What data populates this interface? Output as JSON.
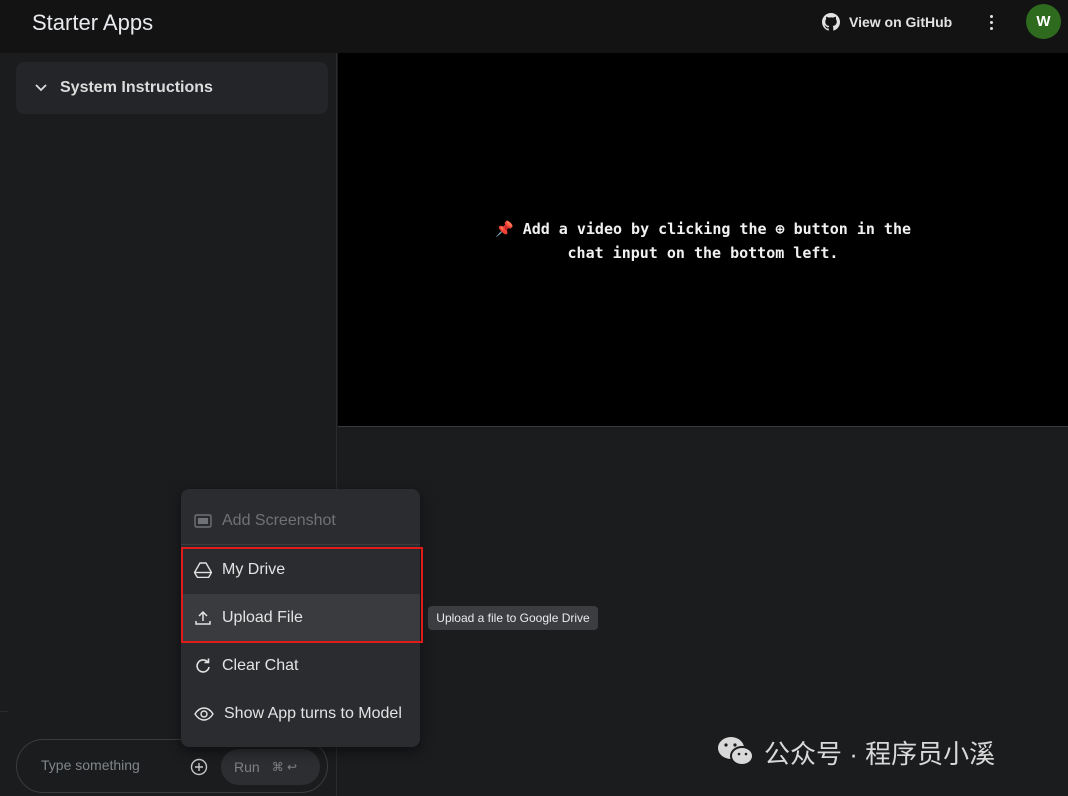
{
  "header": {
    "title": "Starter Apps",
    "github_label": "View on GitHub",
    "avatar_initial": "W"
  },
  "sidebar": {
    "system_instructions_label": "System Instructions"
  },
  "chat_input": {
    "placeholder": "Type something",
    "run_label": "Run",
    "shortcut": "⌘ ↩"
  },
  "video": {
    "pin_icon": "📌",
    "message_line1": "Add a video by clicking the ⊕ button in the",
    "message_line2": "chat input on the bottom left."
  },
  "menu": {
    "items": [
      {
        "label": "Add Screenshot",
        "icon": "screenshot-icon",
        "disabled": true
      },
      {
        "label": "My Drive",
        "icon": "drive-icon",
        "disabled": false
      },
      {
        "label": "Upload File",
        "icon": "upload-icon",
        "disabled": false
      },
      {
        "label": "Clear Chat",
        "icon": "refresh-icon",
        "disabled": false
      },
      {
        "label": "Show App turns to Model",
        "icon": "eye-icon",
        "disabled": false
      }
    ]
  },
  "tooltip": {
    "text": "Upload a file to Google Drive"
  },
  "watermark": {
    "text": "公众号 · 程序员小溪"
  },
  "colors": {
    "highlight": "#e01b1b",
    "avatar": "#2e6b1e"
  }
}
